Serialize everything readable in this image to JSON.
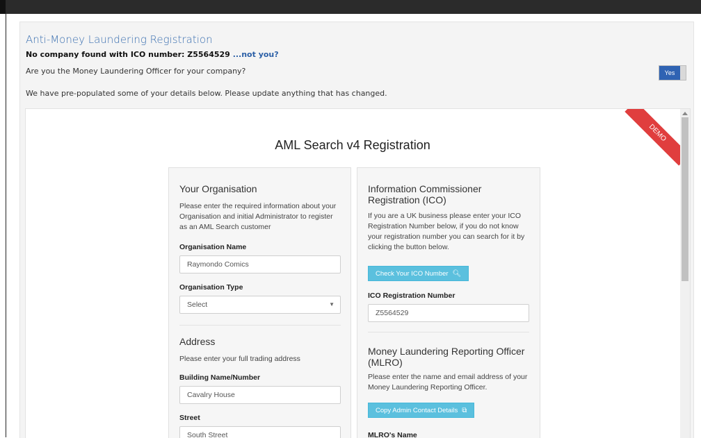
{
  "header": {
    "title": "Anti-Money Laundering Registration",
    "no_company_text": "No company found with ICO number: Z5564529",
    "not_you_link": "...not you?",
    "question": "Are you the Money Laundering Officer for your company?",
    "toggle_label": "Yes",
    "prepopulated_note": "We have pre-populated some of your details below. Please update anything that has changed."
  },
  "ribbon": "DEMO",
  "form": {
    "title": "AML Search v4 Registration",
    "organisation": {
      "heading": "Your Organisation",
      "description": "Please enter the required information about your Organisation and initial Administrator to register as an AML Search customer",
      "name_label": "Organisation Name",
      "name_value": "Raymondo Comics",
      "type_label": "Organisation Type",
      "type_value": "Select"
    },
    "address": {
      "heading": "Address",
      "description": "Please enter your full trading address",
      "building_label": "Building Name/Number",
      "building_value": "Cavalry House",
      "street_label": "Street",
      "street_value": "South Street"
    },
    "ico": {
      "heading": "Information Commissioner Registration (ICO)",
      "description": "If you are a UK business please enter your ICO Registration Number below, if you do not know your registration number you can search for it by clicking the button below.",
      "check_button": "Check Your ICO Number",
      "number_label": "ICO Registration Number",
      "number_value": "Z5564529"
    },
    "mlro": {
      "heading": "Money Laundering Reporting Officer (MLRO)",
      "description": "Please enter the name and email address of your Money Laundering Reporting Officer.",
      "copy_button": "Copy Admin Contact Details",
      "name_label": "MLRO's Name"
    }
  },
  "colors": {
    "link_blue": "#2b5fa6",
    "title_blue": "#3a6fb0",
    "toggle_blue": "#2f63b3",
    "button_info": "#5bc0de",
    "ribbon_red": "#e03e3e"
  }
}
